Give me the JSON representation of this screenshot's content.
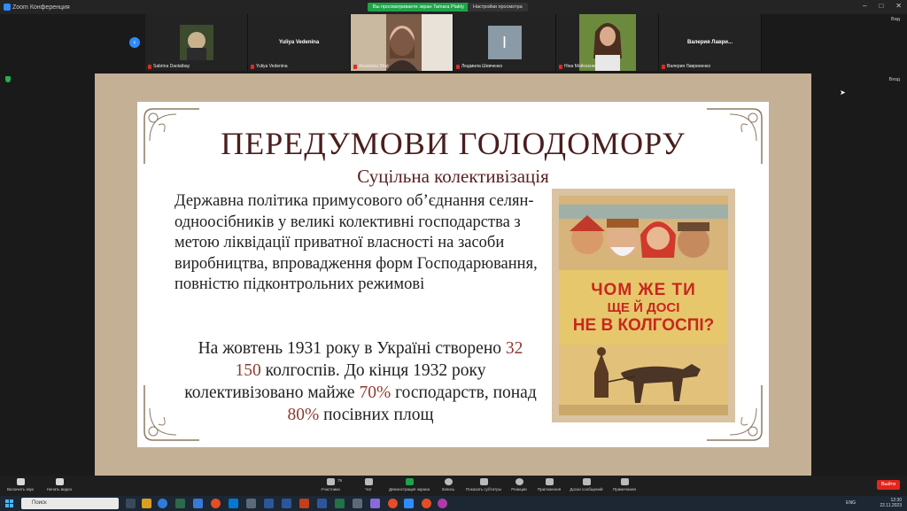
{
  "window": {
    "title": "Zoom Конференция",
    "share_notice": "Вы просматриваете экран Tamara Plakty",
    "view_options": "Настройки просмотра",
    "view_label": "Вид",
    "view_label_secondary": "Вход"
  },
  "participants": [
    {
      "name": "Sabrina Daolatbay",
      "type": "photo"
    },
    {
      "name": "Yuliya Vedenina",
      "type": "name"
    },
    {
      "name": "Anastasia Shut",
      "type": "video"
    },
    {
      "name": "Людмила Шевченко",
      "type": "initial",
      "initial": "I"
    },
    {
      "name": "Ніна Мойсеєнко",
      "type": "photo"
    },
    {
      "name": "Валерия Лавриненко",
      "type": "name",
      "display": "Валерия Лаври..."
    }
  ],
  "slide": {
    "title": "ПЕРЕДУМОВИ ГОЛОДОМОРУ",
    "subtitle": "Суцільна колективізація",
    "body": "Державна політика примусового об’єднання селян-одноосібників у великі колективні господарства з метою ліквідації приватної власності на засоби виробництва, впровадження форм Господарювання, повністю підконтрольних режимові",
    "stats": {
      "p1": "На жовтень 1931 року в Україні створено ",
      "n1": "32 150",
      "p2": " колгоспів. До кінця 1932 року колективізовано майже ",
      "n2": "70%",
      "p3": " господарств, понад ",
      "n3": "80%",
      "p4": " посівних площ"
    },
    "poster": {
      "line1": "ЧОМ ЖЕ ТИ",
      "line2": "ЩЕ Й ДОСІ",
      "line3": "НЕ В КОЛГОСПІ?"
    }
  },
  "toolbar": {
    "mic": "Включить звук",
    "video": "Начать видео",
    "participants": "Участники",
    "participants_count": "79",
    "chat": "Чат",
    "share": "Демонстрация экрана",
    "record": "Запись",
    "captions": "Показать субтитры",
    "reactions": "Реакции",
    "apps": "Приложения",
    "whiteboard": "Доски сообщений",
    "notes": "Примечания",
    "leave": "Выйти"
  },
  "taskbar": {
    "search_placeholder": "Поиск",
    "lang": "ENG",
    "time": "12:30",
    "date": "22.11.2023"
  },
  "colors": {
    "accent": "#2d8cff",
    "share_green": "#1fa34a",
    "leave_red": "#e0261c",
    "slide_title": "#4a1e1e",
    "highlight": "#8e3b32"
  }
}
